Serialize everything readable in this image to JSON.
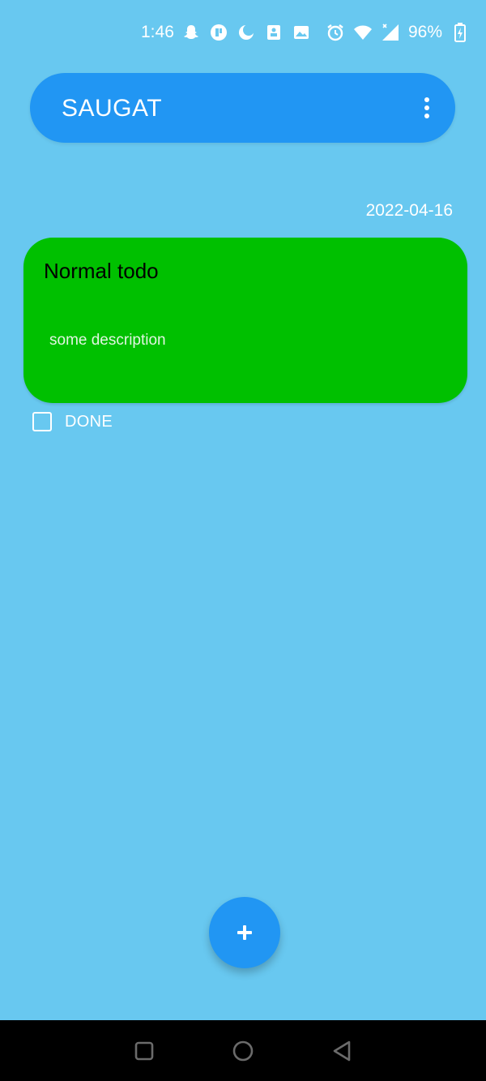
{
  "status_bar": {
    "time": "1:46",
    "battery": "96%",
    "icons": [
      "snapchat-icon",
      "app-icon",
      "moon-icon",
      "clipboard-icon",
      "image-icon",
      "alarm-icon",
      "wifi-icon",
      "signal-icon",
      "battery-charging-icon"
    ]
  },
  "app_bar": {
    "title": "SAUGAT",
    "menu_icon": "more-vert-icon",
    "color": "#2196f3"
  },
  "todos": [
    {
      "date": "2022-04-16",
      "title": "Normal todo",
      "description": "some description",
      "card_color": "#00c000",
      "done_label": "DONE",
      "done": false
    }
  ],
  "fab": {
    "icon": "plus-icon",
    "color": "#2196f3"
  },
  "nav_bar": {
    "buttons": [
      "recents-icon",
      "home-icon",
      "back-icon"
    ]
  },
  "colors": {
    "background": "#68c8f0"
  }
}
